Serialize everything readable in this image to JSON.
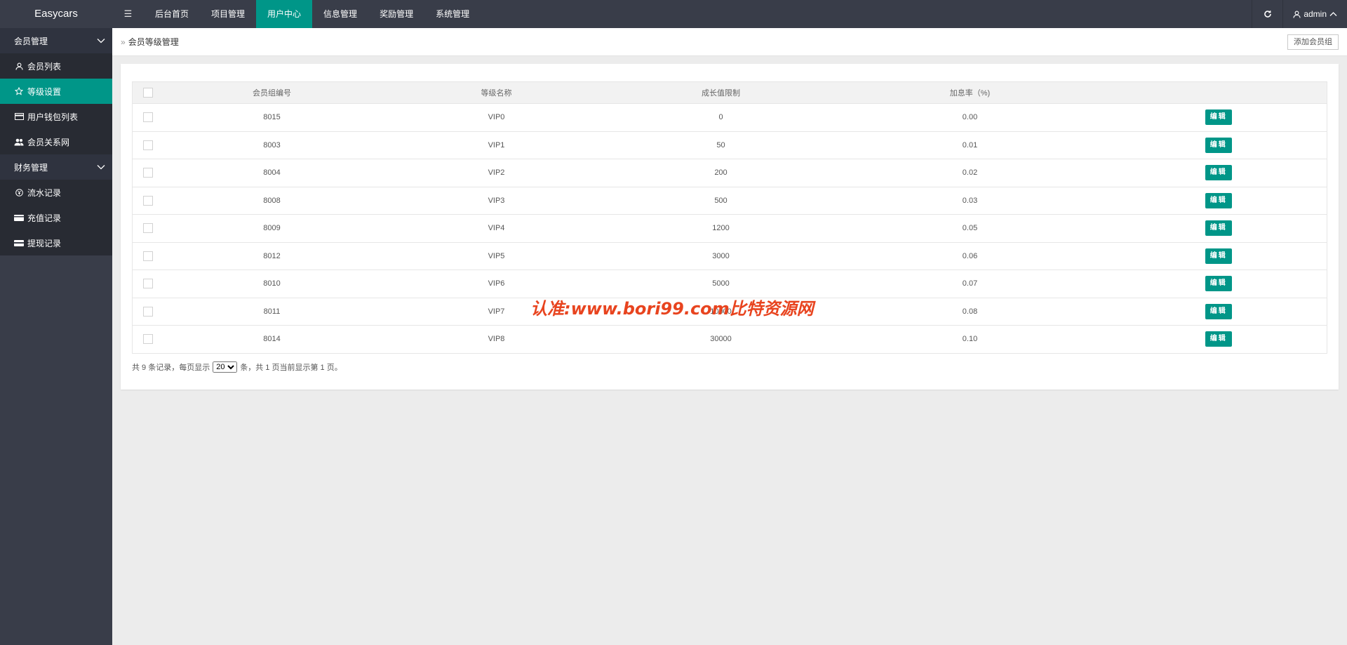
{
  "app": {
    "title": "Easycars"
  },
  "topnav": {
    "menu_icon": "hamburger-icon",
    "items": [
      {
        "label": "后台首页"
      },
      {
        "label": "项目管理"
      },
      {
        "label": "用户中心",
        "active": true
      },
      {
        "label": "信息管理"
      },
      {
        "label": "奖励管理"
      },
      {
        "label": "系统管理"
      }
    ],
    "refresh_icon": "refresh-icon",
    "user": {
      "name": "admin",
      "icon": "user-icon",
      "caret_icon": "chevron-up-icon"
    }
  },
  "sidebar": {
    "groups": [
      {
        "label": "会员管理",
        "items": [
          {
            "label": "会员列表",
            "icon": "user-icon"
          },
          {
            "label": "等级设置",
            "icon": "star-icon",
            "active": true
          },
          {
            "label": "用户钱包列表",
            "icon": "card-icon"
          },
          {
            "label": "会员关系网",
            "icon": "users-icon"
          }
        ]
      },
      {
        "label": "财务管理",
        "items": [
          {
            "label": "流水记录",
            "icon": "currency-icon"
          },
          {
            "label": "充值记录",
            "icon": "recharge-icon"
          },
          {
            "label": "提现记录",
            "icon": "withdraw-icon"
          }
        ]
      }
    ]
  },
  "breadcrumb": {
    "arrow": "»",
    "current": "会员等级管理"
  },
  "toolbar": {
    "add_label": "添加会员组"
  },
  "table": {
    "headers": [
      "会员组编号",
      "等级名称",
      "成长值限制",
      "加息率（%)"
    ],
    "edit_label": "编辑",
    "rows": [
      {
        "id": "8015",
        "name": "VIP0",
        "growth": "0",
        "rate": "0.00"
      },
      {
        "id": "8003",
        "name": "VIP1",
        "growth": "50",
        "rate": "0.01"
      },
      {
        "id": "8004",
        "name": "VIP2",
        "growth": "200",
        "rate": "0.02"
      },
      {
        "id": "8008",
        "name": "VIP3",
        "growth": "500",
        "rate": "0.03"
      },
      {
        "id": "8009",
        "name": "VIP4",
        "growth": "1200",
        "rate": "0.05"
      },
      {
        "id": "8012",
        "name": "VIP5",
        "growth": "3000",
        "rate": "0.06"
      },
      {
        "id": "8010",
        "name": "VIP6",
        "growth": "5000",
        "rate": "0.07"
      },
      {
        "id": "8011",
        "name": "VIP7",
        "growth": "10000",
        "rate": "0.08"
      },
      {
        "id": "8014",
        "name": "VIP8",
        "growth": "30000",
        "rate": "0.10"
      }
    ]
  },
  "pager": {
    "prefix": "共 9 条记录，每页显示",
    "page_size": "20",
    "suffix": "条，共 1 页当前显示第 1 页。"
  },
  "watermark": {
    "text": "认准:www.bori99.com比特资源网"
  },
  "colors": {
    "accent": "#009688",
    "dark": "#393d49",
    "watermark": "#e8441f"
  }
}
